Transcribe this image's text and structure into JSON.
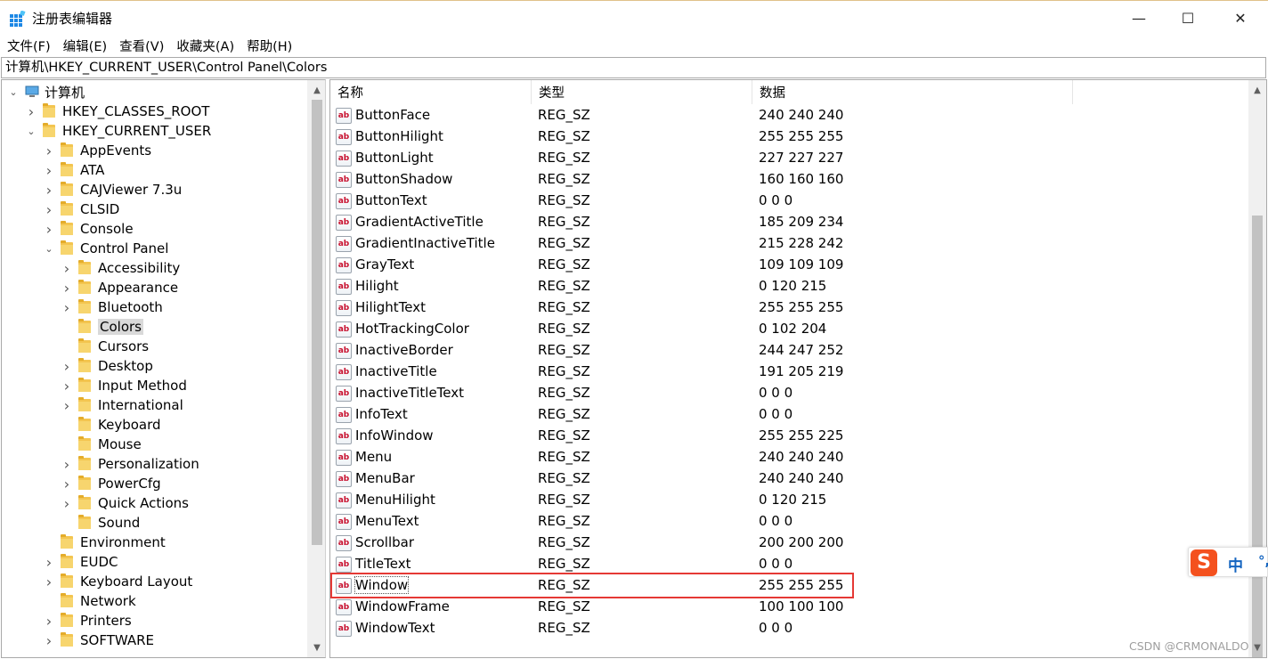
{
  "window": {
    "title": "注册表编辑器",
    "minimize_glyph": "—",
    "maximize_glyph": "☐",
    "close_glyph": "✕"
  },
  "menu": [
    "文件(F)",
    "编辑(E)",
    "查看(V)",
    "收藏夹(A)",
    "帮助(H)"
  ],
  "address": "计算机\\HKEY_CURRENT_USER\\Control Panel\\Colors",
  "tree": {
    "root": "计算机",
    "items": [
      {
        "label": "HKEY_CLASSES_ROOT",
        "depth": 1,
        "expander": "collapsed"
      },
      {
        "label": "HKEY_CURRENT_USER",
        "depth": 1,
        "expander": "expanded"
      },
      {
        "label": "AppEvents",
        "depth": 2,
        "expander": "collapsed"
      },
      {
        "label": "ATA",
        "depth": 2,
        "expander": "collapsed"
      },
      {
        "label": "CAJViewer 7.3u",
        "depth": 2,
        "expander": "collapsed"
      },
      {
        "label": "CLSID",
        "depth": 2,
        "expander": "collapsed"
      },
      {
        "label": "Console",
        "depth": 2,
        "expander": "collapsed"
      },
      {
        "label": "Control Panel",
        "depth": 2,
        "expander": "expanded"
      },
      {
        "label": "Accessibility",
        "depth": 3,
        "expander": "collapsed"
      },
      {
        "label": "Appearance",
        "depth": 3,
        "expander": "collapsed"
      },
      {
        "label": "Bluetooth",
        "depth": 3,
        "expander": "collapsed"
      },
      {
        "label": "Colors",
        "depth": 3,
        "expander": "none",
        "selected": true
      },
      {
        "label": "Cursors",
        "depth": 3,
        "expander": "none"
      },
      {
        "label": "Desktop",
        "depth": 3,
        "expander": "collapsed"
      },
      {
        "label": "Input Method",
        "depth": 3,
        "expander": "collapsed"
      },
      {
        "label": "International",
        "depth": 3,
        "expander": "collapsed"
      },
      {
        "label": "Keyboard",
        "depth": 3,
        "expander": "none"
      },
      {
        "label": "Mouse",
        "depth": 3,
        "expander": "none"
      },
      {
        "label": "Personalization",
        "depth": 3,
        "expander": "collapsed"
      },
      {
        "label": "PowerCfg",
        "depth": 3,
        "expander": "collapsed"
      },
      {
        "label": "Quick Actions",
        "depth": 3,
        "expander": "collapsed"
      },
      {
        "label": "Sound",
        "depth": 3,
        "expander": "none"
      },
      {
        "label": "Environment",
        "depth": 2,
        "expander": "none"
      },
      {
        "label": "EUDC",
        "depth": 2,
        "expander": "collapsed"
      },
      {
        "label": "Keyboard Layout",
        "depth": 2,
        "expander": "collapsed"
      },
      {
        "label": "Network",
        "depth": 2,
        "expander": "none"
      },
      {
        "label": "Printers",
        "depth": 2,
        "expander": "collapsed"
      },
      {
        "label": "SOFTWARE",
        "depth": 2,
        "expander": "collapsed"
      }
    ]
  },
  "list": {
    "columns": [
      "名称",
      "类型",
      "数据"
    ],
    "rows": [
      {
        "name": "ButtonFace",
        "type": "REG_SZ",
        "data": "240 240 240"
      },
      {
        "name": "ButtonHilight",
        "type": "REG_SZ",
        "data": "255 255 255"
      },
      {
        "name": "ButtonLight",
        "type": "REG_SZ",
        "data": "227 227 227"
      },
      {
        "name": "ButtonShadow",
        "type": "REG_SZ",
        "data": "160 160 160"
      },
      {
        "name": "ButtonText",
        "type": "REG_SZ",
        "data": "0 0 0"
      },
      {
        "name": "GradientActiveTitle",
        "type": "REG_SZ",
        "data": "185 209 234"
      },
      {
        "name": "GradientInactiveTitle",
        "type": "REG_SZ",
        "data": "215 228 242"
      },
      {
        "name": "GrayText",
        "type": "REG_SZ",
        "data": "109 109 109"
      },
      {
        "name": "Hilight",
        "type": "REG_SZ",
        "data": "0 120 215"
      },
      {
        "name": "HilightText",
        "type": "REG_SZ",
        "data": "255 255 255"
      },
      {
        "name": "HotTrackingColor",
        "type": "REG_SZ",
        "data": "0 102 204"
      },
      {
        "name": "InactiveBorder",
        "type": "REG_SZ",
        "data": "244 247 252"
      },
      {
        "name": "InactiveTitle",
        "type": "REG_SZ",
        "data": "191 205 219"
      },
      {
        "name": "InactiveTitleText",
        "type": "REG_SZ",
        "data": "0 0 0"
      },
      {
        "name": "InfoText",
        "type": "REG_SZ",
        "data": "0 0 0"
      },
      {
        "name": "InfoWindow",
        "type": "REG_SZ",
        "data": "255 255 225"
      },
      {
        "name": "Menu",
        "type": "REG_SZ",
        "data": "240 240 240"
      },
      {
        "name": "MenuBar",
        "type": "REG_SZ",
        "data": "240 240 240"
      },
      {
        "name": "MenuHilight",
        "type": "REG_SZ",
        "data": "0 120 215"
      },
      {
        "name": "MenuText",
        "type": "REG_SZ",
        "data": "0 0 0"
      },
      {
        "name": "Scrollbar",
        "type": "REG_SZ",
        "data": "200 200 200"
      },
      {
        "name": "TitleText",
        "type": "REG_SZ",
        "data": "0 0 0"
      },
      {
        "name": "Window",
        "type": "REG_SZ",
        "data": "255 255 255",
        "highlighted": true
      },
      {
        "name": "WindowFrame",
        "type": "REG_SZ",
        "data": "100 100 100"
      },
      {
        "name": "WindowText",
        "type": "REG_SZ",
        "data": "0 0 0"
      }
    ]
  },
  "value_icon_text": "ab",
  "ime": {
    "logo": "S",
    "mode": "中",
    "punct": "°,"
  },
  "watermark": "CSDN @CRMONALDO",
  "colors": {
    "highlight_border": "#e53935",
    "selection_bg": "#d9d9d9",
    "ime_brand": "#f4511e"
  }
}
